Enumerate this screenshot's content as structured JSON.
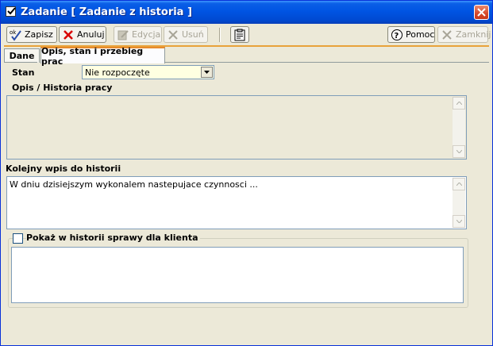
{
  "window": {
    "title": "Zadanie  [ Zadanie z historia ]",
    "icons": {
      "title": "checkbox-icon",
      "close": "close-icon"
    },
    "accent_color": "#0054e3",
    "close_color": "#d7482a"
  },
  "toolbar": {
    "save_label": "Zapisz",
    "cancel_label": "Anuluj",
    "edit_label": "Edycja",
    "delete_label": "Usuń",
    "help_label": "Pomoc",
    "close_label": "Zamknij",
    "icons": {
      "save": "ok-icon",
      "cancel": "red-x-icon",
      "edit": "edit-icon",
      "delete": "gray-x-icon",
      "notes": "clipboard-icon",
      "help": "help-icon",
      "close": "gray-x-icon"
    },
    "disabled": [
      "edit",
      "delete",
      "close"
    ]
  },
  "tabs": [
    {
      "label": "Dane",
      "active": false
    },
    {
      "label": "Opis, stan i przebieg prac",
      "active": true
    }
  ],
  "form": {
    "stan_label": "Stan",
    "stan_value": "Nie rozpoczęte",
    "history_label": "Opis / Historia pracy",
    "history_value": "",
    "next_entry_label": "Kolejny wpis do historii",
    "next_entry_value": "W dniu dzisiejszym wykonalem nastepujace czynnosci ...",
    "show_checkbox_label": "Pokaż w historii sprawy dla klienta",
    "show_checkbox_checked": false,
    "client_text_value": ""
  }
}
